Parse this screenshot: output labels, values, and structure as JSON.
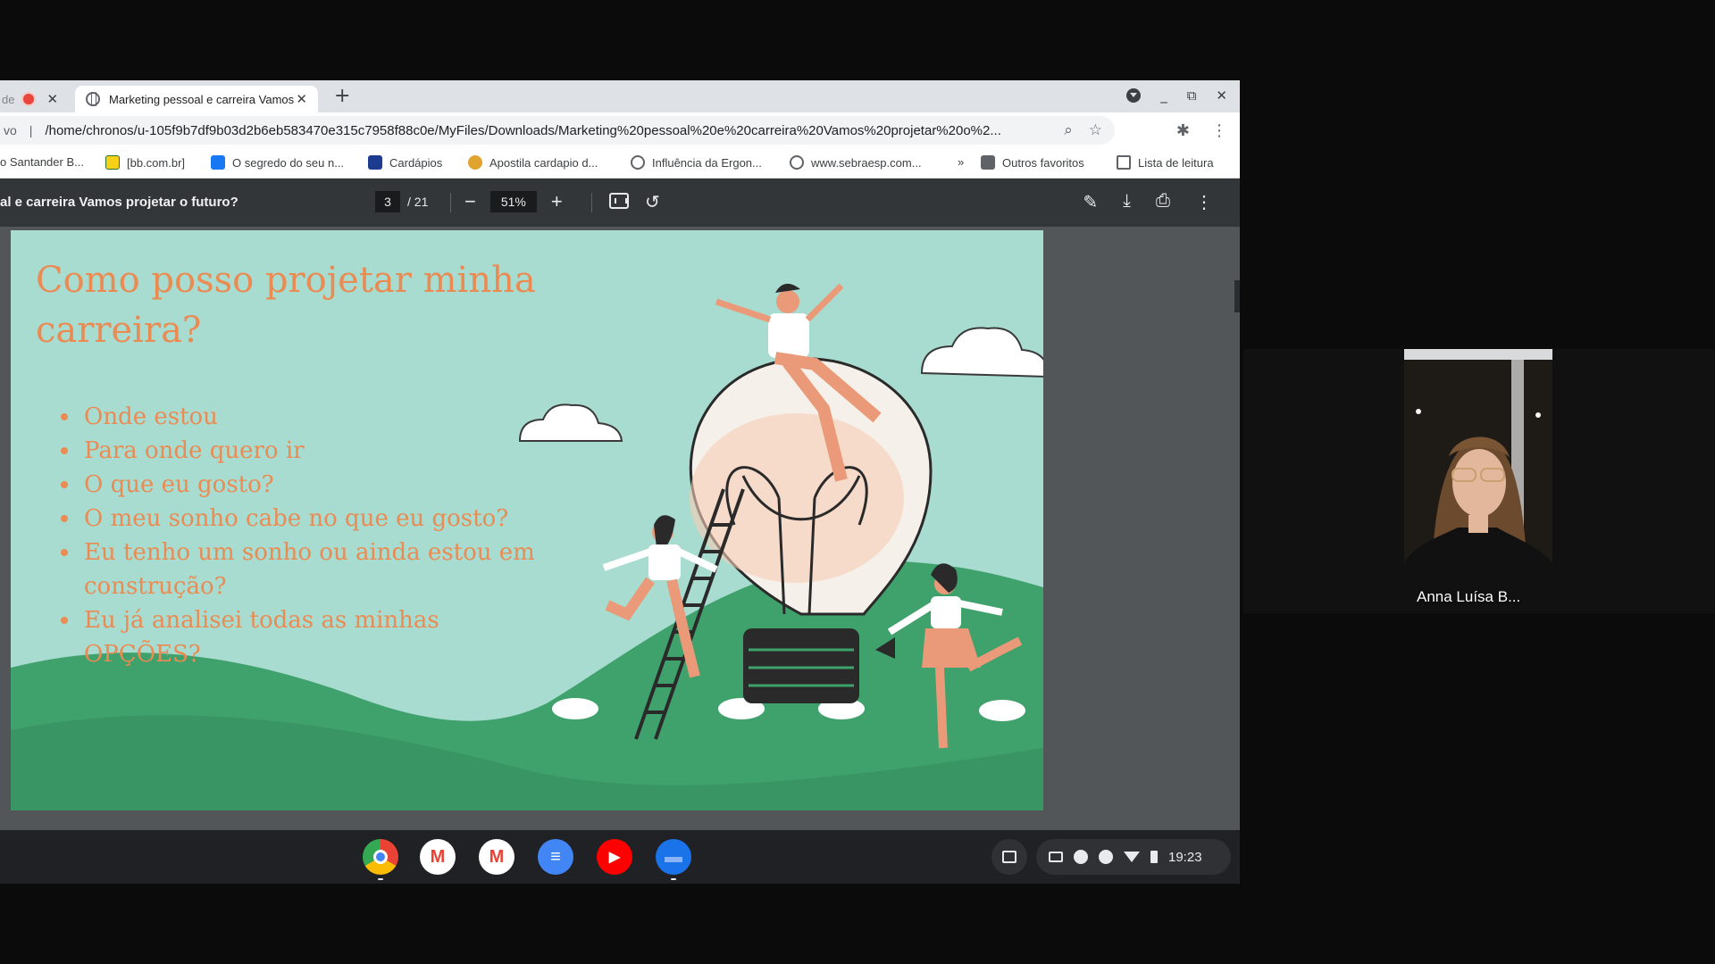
{
  "browser": {
    "prev_tab_text": "de",
    "active_tab_title": "Marketing pessoal e carreira Vamos",
    "new_tab_symbol": "+",
    "url_prefix": "vo",
    "url": "/home/chronos/u-105f9b7df9b03d2b6eb583470e315c7958f88c0e/MyFiles/Downloads/Marketing%20pessoal%20e%20carreira%20Vamos%20projetar%20o%2...",
    "bookmarks": [
      {
        "label": "o Santander B...",
        "color": "#ec0000"
      },
      {
        "label": "[bb.com.br]",
        "color": "#f7d117"
      },
      {
        "label": "O segredo do seu n...",
        "color": "#1877f2"
      },
      {
        "label": "Cardápios",
        "color": "#1d3c8f"
      },
      {
        "label": "Apostila cardapio d...",
        "color": "#e0a32e"
      },
      {
        "label": "Influência da Ergon...",
        "color": "#5f6368"
      },
      {
        "label": "www.sebraesp.com...",
        "color": "#5f6368"
      }
    ],
    "bookmarks_more": "»",
    "other_bookmarks": "Outros favoritos",
    "reading_list": "Lista de leitura"
  },
  "pdf": {
    "title": "al e carreira Vamos projetar o futuro?",
    "current_page": "3",
    "total_pages": "/ 21",
    "zoom": "51%"
  },
  "slide": {
    "title": "Como posso projetar minha carreira?",
    "bullets": [
      "Onde estou",
      "Para onde quero ir",
      "O que eu gosto?",
      "O meu sonho cabe no que eu gosto?",
      "Eu tenho um sonho ou ainda estou em construção?",
      "Eu já analisei todas as minhas OPÇÕES?"
    ],
    "colors": {
      "background": "#a8dcd0",
      "text": "#ea8b53",
      "hill": "#3fa16b",
      "skin": "#ea9a78"
    }
  },
  "shelf": {
    "apps": [
      {
        "name": "chrome",
        "glyph": "",
        "color": "#ffffff"
      },
      {
        "name": "gmail",
        "glyph": "M",
        "color": "#ffffff"
      },
      {
        "name": "gmail",
        "glyph": "M",
        "color": "#ffffff"
      },
      {
        "name": "docs",
        "glyph": "≡",
        "color": "#4285f4"
      },
      {
        "name": "youtube",
        "glyph": "▶",
        "color": "#ff0000"
      },
      {
        "name": "files",
        "glyph": "▬",
        "color": "#1a73e8"
      }
    ],
    "time": "19:23"
  },
  "participant": {
    "name": "Anna Luísa B..."
  }
}
